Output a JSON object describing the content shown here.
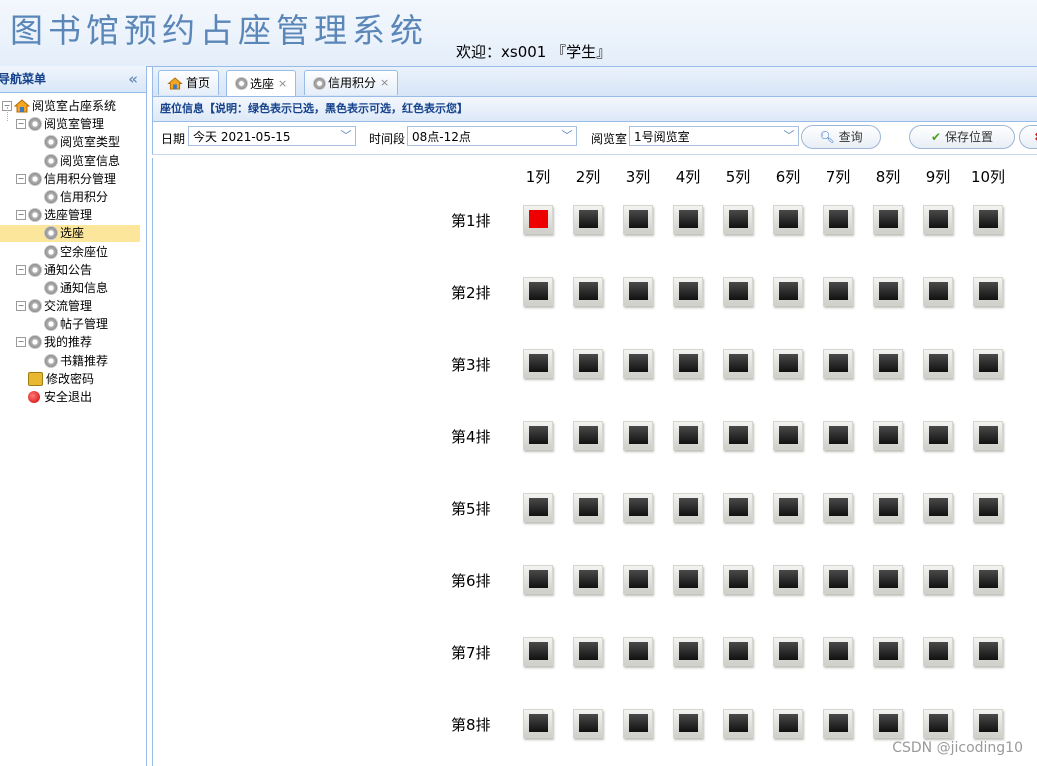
{
  "app": {
    "title": "图书馆预约占座管理系统",
    "welcome": "欢迎：xs001 『学生』"
  },
  "sidebar": {
    "title": "导航菜单",
    "collapse_glyph": "«",
    "root": "阅览室占座系统",
    "items": [
      {
        "label": "阅览室管理",
        "level": 1
      },
      {
        "label": "阅览室类型",
        "level": 2
      },
      {
        "label": "阅览室信息",
        "level": 2
      },
      {
        "label": "信用积分管理",
        "level": 1
      },
      {
        "label": "信用积分",
        "level": 2
      },
      {
        "label": "选座管理",
        "level": 1
      },
      {
        "label": "选座",
        "level": 2,
        "selected": true
      },
      {
        "label": "空余座位",
        "level": 2
      },
      {
        "label": "通知公告",
        "level": 1
      },
      {
        "label": "通知信息",
        "level": 2
      },
      {
        "label": "交流管理",
        "level": 1
      },
      {
        "label": "帖子管理",
        "level": 2
      },
      {
        "label": "我的推荐",
        "level": 1
      },
      {
        "label": "书籍推荐",
        "level": 2
      },
      {
        "label": "修改密码",
        "level": 1,
        "icon": "key-icon"
      },
      {
        "label": "安全退出",
        "level": 1,
        "icon": "exit-icon"
      }
    ]
  },
  "tabs": [
    {
      "label": "首页",
      "icon": "home-icon",
      "closable": false
    },
    {
      "label": "选座",
      "icon": "gear-icon",
      "closable": true,
      "active": true
    },
    {
      "label": "信用积分",
      "icon": "gear-icon",
      "closable": true
    }
  ],
  "info": "座位信息【说明：绿色表示已选，黑色表示可选，红色表示您】",
  "toolbar": {
    "date_label": "日期",
    "date_value": "今天  2021-05-15",
    "time_label": "时间段",
    "time_value": "08点-12点",
    "room_label": "阅览室",
    "room_value": "1号阅览室",
    "query_label": "查询",
    "save_label": "保存位置"
  },
  "seat_map": {
    "columns": [
      "1列",
      "2列",
      "3列",
      "4列",
      "5列",
      "6列",
      "7列",
      "8列",
      "9列",
      "10列"
    ],
    "rows": [
      "第1排",
      "第2排",
      "第3排",
      "第4排",
      "第5排",
      "第6排",
      "第7排",
      "第8排"
    ],
    "seat_colors": {
      "available": "#1a1a1a",
      "mine": "#ee0000",
      "taken": "#00aa00"
    },
    "my_seat": {
      "row": 1,
      "col": 1
    }
  },
  "watermark": "CSDN @jicoding10"
}
